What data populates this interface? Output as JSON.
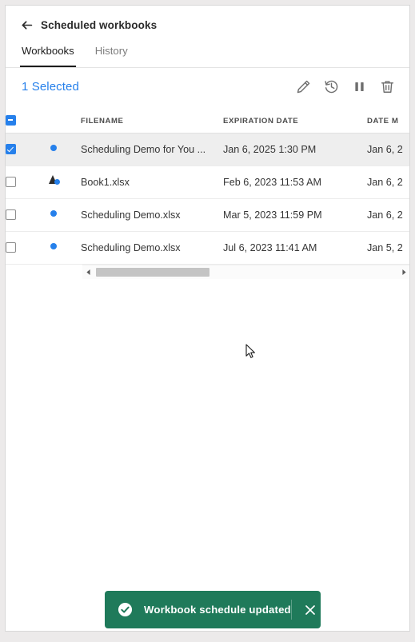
{
  "header": {
    "back_icon": "back-arrow-icon",
    "title": "Scheduled workbooks"
  },
  "tabs": [
    {
      "label": "Workbooks",
      "active": true
    },
    {
      "label": "History",
      "active": false
    }
  ],
  "action_bar": {
    "selection_count": "1 Selected",
    "icons": [
      {
        "name": "edit-icon",
        "label": "Edit"
      },
      {
        "name": "history-icon",
        "label": "History"
      },
      {
        "name": "pause-icon",
        "label": "Pause"
      },
      {
        "name": "delete-icon",
        "label": "Delete"
      }
    ]
  },
  "table": {
    "columns": [
      {
        "key": "check",
        "label": ""
      },
      {
        "key": "status",
        "label": ""
      },
      {
        "key": "filename",
        "label": "FILENAME"
      },
      {
        "key": "expiration",
        "label": "EXPIRATION DATE"
      },
      {
        "key": "modified",
        "label": "DATE M"
      }
    ],
    "header_checkbox_state": "indeterminate",
    "rows": [
      {
        "selected": true,
        "checkbox_state": "checked",
        "status_icon": "status-dot-icon",
        "filename": "Scheduling Demo for You ...",
        "expiration": "Jan 6, 2025 1:30 PM",
        "modified": "Jan 6, 2"
      },
      {
        "selected": false,
        "checkbox_state": "unchecked",
        "status_icon": "status-alert-icon",
        "filename": "Book1.xlsx",
        "expiration": "Feb 6, 2023 11:53 AM",
        "modified": "Jan 6, 2"
      },
      {
        "selected": false,
        "checkbox_state": "unchecked",
        "status_icon": "status-dot-icon",
        "filename": "Scheduling Demo.xlsx",
        "expiration": "Mar 5, 2023 11:59 PM",
        "modified": "Jan 6, 2"
      },
      {
        "selected": false,
        "checkbox_state": "unchecked",
        "status_icon": "status-dot-icon",
        "filename": "Scheduling Demo.xlsx",
        "expiration": "Jul 6, 2023 11:41 AM",
        "modified": "Jan 5, 2"
      }
    ]
  },
  "scrollbar": {
    "left_arrow": "scroll-left-arrow-icon",
    "right_arrow": "scroll-right-arrow-icon"
  },
  "toast": {
    "message": "Workbook schedule updated",
    "icon": "success-check-icon",
    "close_icon": "close-icon",
    "background_color": "#1f7a5a"
  },
  "colors": {
    "accent_blue": "#2680eb",
    "toast_green": "#1f7a5a",
    "page_background": "#eceaea",
    "panel_background": "#ffffff",
    "selected_row": "#eeeeee"
  }
}
